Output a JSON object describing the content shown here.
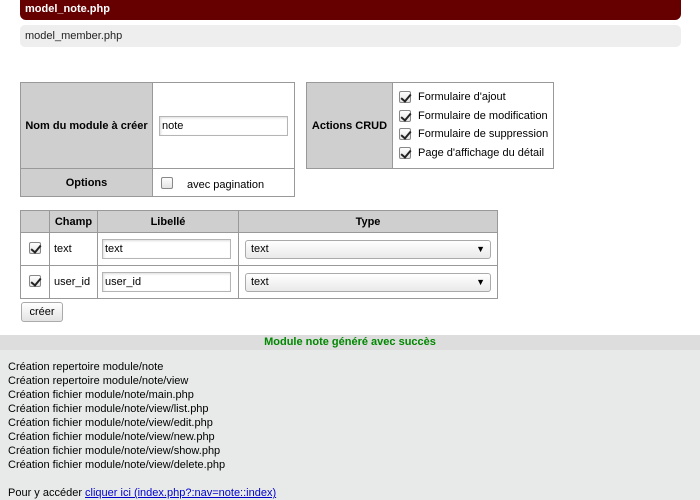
{
  "files": {
    "active": "model_note.php",
    "items": [
      "model_member.php"
    ]
  },
  "form": {
    "module_name_label": "Nom du module à créer",
    "module_name_value": "note",
    "options_label": "Options",
    "pagination_label": "avec pagination",
    "pagination_checked": false,
    "crud_label": "Actions CRUD",
    "crud_options": [
      {
        "label": "Formulaire d'ajout",
        "checked": true
      },
      {
        "label": "Formulaire de modification",
        "checked": true
      },
      {
        "label": "Formulaire de suppression",
        "checked": true
      },
      {
        "label": "Page d'affichage du détail",
        "checked": true
      }
    ]
  },
  "fields_table": {
    "headers": [
      "",
      "Champ",
      "Libellé",
      "Type"
    ],
    "rows": [
      {
        "checked": true,
        "champ": "text",
        "libelle": "text",
        "type": "text"
      },
      {
        "checked": true,
        "champ": "user_id",
        "libelle": "user_id",
        "type": "text"
      }
    ]
  },
  "create_button": "créer",
  "success_message": "Module note généré avec succès",
  "log_lines": [
    "Création repertoire module/note",
    "Création repertoire module/note/view",
    "Création fichier module/note/main.php",
    "Création fichier module/note/view/list.php",
    "Création fichier module/note/view/edit.php",
    "Création fichier module/note/view/new.php",
    "Création fichier module/note/view/show.php",
    "Création fichier module/note/view/delete.php"
  ],
  "access": {
    "prefix": "Pour y accéder",
    "link": "cliquer ici (index.php?:nav=note::index)"
  },
  "colors": {
    "active_file_bg": "#660000",
    "success_text": "#008800",
    "link": "#0000cc"
  }
}
